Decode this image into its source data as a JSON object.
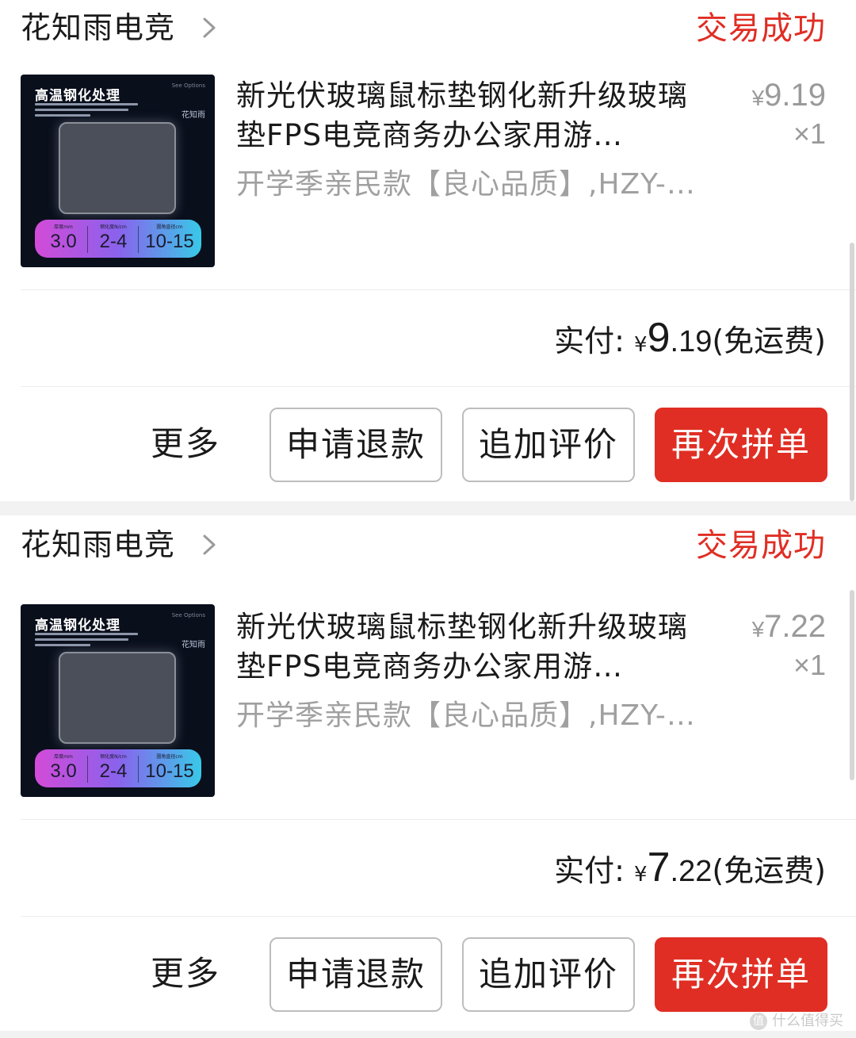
{
  "orders": [
    {
      "store_name": "花知雨电竞",
      "status": "交易成功",
      "product": {
        "thumb_title": "高温钢化处理",
        "thumb_brand": "花知雨",
        "thumb_tiny": "See Options",
        "spec1": "3.0",
        "spec2": "2-4",
        "spec3": "10-15",
        "title": "新光伏玻璃鼠标垫钢化新升级玻璃垫FPS电竞商务办公家用游…",
        "variant": "开学季亲民款【良心品质】,HZY-…",
        "unit_price_symbol": "¥",
        "unit_price": "9.19",
        "quantity": "×1"
      },
      "paid": {
        "label": "实付: ",
        "symbol": "¥",
        "amount_int": "9",
        "amount_dec": ".19",
        "note": "(免运费)"
      },
      "actions": {
        "more": "更多",
        "refund": "申请退款",
        "review": "追加评价",
        "rebuy": "再次拼单"
      }
    },
    {
      "store_name": "花知雨电竞",
      "status": "交易成功",
      "product": {
        "thumb_title": "高温钢化处理",
        "thumb_brand": "花知雨",
        "thumb_tiny": "See Options",
        "spec1": "3.0",
        "spec2": "2-4",
        "spec3": "10-15",
        "title": "新光伏玻璃鼠标垫钢化新升级玻璃垫FPS电竞商务办公家用游…",
        "variant": "开学季亲民款【良心品质】,HZY-…",
        "unit_price_symbol": "¥",
        "unit_price": "7.22",
        "quantity": "×1"
      },
      "paid": {
        "label": "实付: ",
        "symbol": "¥",
        "amount_int": "7",
        "amount_dec": ".22",
        "note": "(免运费)"
      },
      "actions": {
        "more": "更多",
        "refund": "申请退款",
        "review": "追加评价",
        "rebuy": "再次拼单"
      }
    }
  ],
  "watermark": {
    "icon": "值",
    "text": "什么值得买"
  },
  "colors": {
    "accent": "#e02e24",
    "muted_text": "#a0a0a0",
    "page_bg": "#f2f2f2"
  }
}
